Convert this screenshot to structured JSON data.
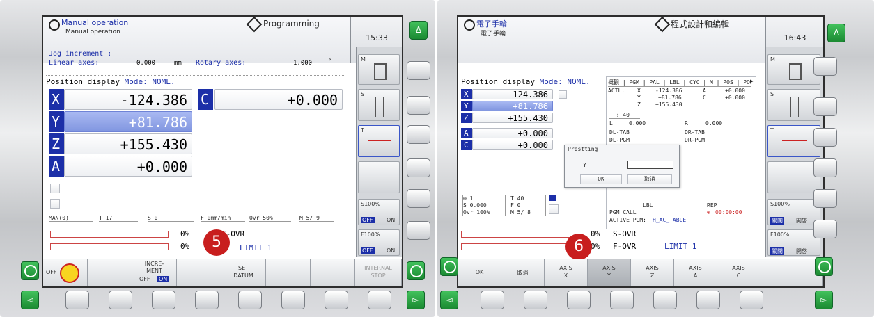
{
  "left": {
    "header": {
      "title": "Manual operation",
      "subtitle": "Manual operation",
      "mode_label": "Programming",
      "clock": "15:33"
    },
    "jog": {
      "title": "Jog increment :",
      "linear_label": "Linear axes:",
      "linear_value": "0.000",
      "linear_unit": "mm",
      "rotary_label": "Rotary axes:",
      "rotary_value": "1.000",
      "rotary_unit": "°"
    },
    "position": {
      "title": "Position display",
      "mode": "Mode: NOML."
    },
    "axes": [
      {
        "label": "X",
        "value": "-124.386"
      },
      {
        "label": "Y",
        "value": "+81.786"
      },
      {
        "label": "Z",
        "value": "+155.430"
      },
      {
        "label": "A",
        "value": "+0.000"
      },
      {
        "label": "C",
        "value": "+0.000"
      }
    ],
    "status": [
      "MAN(0)",
      "T 17",
      "S 0",
      "F 0mm/min",
      "Ovr 50%",
      "M 5/ 9"
    ],
    "overrides": {
      "s_percent": "0%",
      "f_percent": "0%",
      "s_label": "S-OVR",
      "limit": "LIMIT 1"
    },
    "side_softkeys": {
      "m": "M",
      "s": "S",
      "t": "T",
      "s100": "S100%",
      "f100": "F100%",
      "off": "OFF",
      "on": "ON"
    },
    "softkeys": {
      "off": "OFF",
      "increment_l1": "INCRE-",
      "increment_l2": "MENT",
      "increment_off": "OFF",
      "increment_on": "ON",
      "set_datum_l1": "SET",
      "set_datum_l2": "DATUM",
      "internal_stop_l1": "INTERNAL",
      "internal_stop_l2": "STOP"
    },
    "badge": "5",
    "side_button": "Δ",
    "nav_left": "◅",
    "nav_right": "▻"
  },
  "right": {
    "header": {
      "title": "電子手輪",
      "subtitle": "電子手輪",
      "mode_label": "程式設計和編輯",
      "clock": "16:43"
    },
    "position": {
      "title": "Position display",
      "mode": "Mode: NOML."
    },
    "axes": [
      {
        "label": "X",
        "value": "-124.386"
      },
      {
        "label": "Y",
        "value": "+81.786"
      },
      {
        "label": "Z",
        "value": "+155.430"
      },
      {
        "label": "A",
        "value": "+0.000"
      },
      {
        "label": "C",
        "value": "+0.000"
      }
    ],
    "tabs": "概觀 | PGM | PAL | LBL | CYC | M | POS | POS HR |",
    "actl": {
      "label": "ACTL.",
      "x_label": "X",
      "x": "-124.386",
      "a_label": "A",
      "a": "+0.000",
      "y_label": "Y",
      "y": "+81.786",
      "c_label": "C",
      "c": "+0.000",
      "z_label": "Z",
      "z": "+155.430"
    },
    "tool": {
      "t": "T : 40",
      "l_label": "L",
      "l": "0.000",
      "r_label": "R",
      "r": "0.000",
      "dl_tab": "DL-TAB",
      "dr_tab": "DR-TAB",
      "dl_pgm": "DL-PGM",
      "dr_pgm": "DR-PGM"
    },
    "dialog": {
      "title": "Prestting",
      "axis": "Y",
      "ok": "OK",
      "cancel": "取消"
    },
    "status": {
      "s1": "1",
      "t": "T 40",
      "s": "S 0.000",
      "f": "F 0",
      "ovr": "Ovr 100%",
      "m": "M 5/ 8"
    },
    "pgm": {
      "lbl": "LBL",
      "rep": "REP",
      "call": "PGM CALL",
      "time": "00:00:00",
      "active_label": "ACTIVE PGM:",
      "active_value": "H_AC_TABLE"
    },
    "overrides": {
      "s_percent": "0%",
      "f_percent": "0%",
      "s_label": "S-OVR",
      "f_label": "F-OVR",
      "limit": "LIMIT 1"
    },
    "side_softkeys": {
      "m": "M",
      "s": "S",
      "t": "T",
      "s100": "S100%",
      "f100": "F100%",
      "on": "開啓",
      "off": "關閉"
    },
    "softkeys": {
      "ok": "OK",
      "cancel": "取消",
      "axis": "AXIS",
      "x": "X",
      "y": "Y",
      "z": "Z",
      "a": "A",
      "c": "C"
    },
    "badge": "6",
    "side_button": "Δ",
    "nav_left": "◅",
    "nav_right": "▻"
  },
  "colors": {
    "axis_blue": "#1c2fa8",
    "selected_blue": "#8196e0",
    "badge_red": "#c81e1e",
    "hw_green": "#2aa844"
  }
}
